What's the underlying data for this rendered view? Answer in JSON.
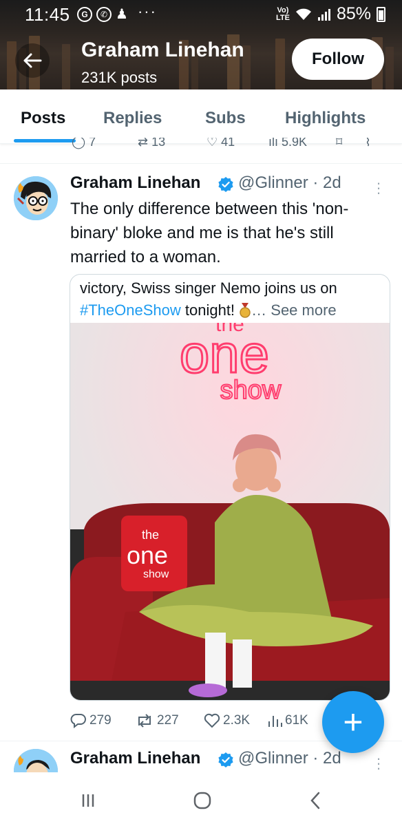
{
  "status_bar": {
    "time": "11:45",
    "network": "Vo) LTE",
    "battery": "85%"
  },
  "header": {
    "profile_name": "Graham Linehan",
    "posts_count": "231K posts",
    "follow_label": "Follow"
  },
  "tabs": [
    {
      "label": "Posts",
      "active": true
    },
    {
      "label": "Replies",
      "active": false
    },
    {
      "label": "Subs",
      "active": false
    },
    {
      "label": "Highlights",
      "active": false
    }
  ],
  "prev_post_actions": {
    "replies": "7",
    "reposts": "13",
    "likes": "41",
    "views": "5.9K"
  },
  "tweet": {
    "author_name": "Graham Linehan",
    "handle_time": "@Glinner · 2d",
    "text": "The only difference between this 'non-binary' bloke and me is that he's still married to a woman.",
    "embed": {
      "text_before": "victory, Swiss singer Nemo joins us on",
      "hashtag": "#TheOneShow",
      "text_after": " tonight! ",
      "see_more": "… See more",
      "sign_line1": "one",
      "sign_line2": "show",
      "sign_top": "the",
      "cushion_top": "the",
      "cushion_mid": "one",
      "cushion_bottom": "show"
    },
    "actions": {
      "replies": "279",
      "reposts": "227",
      "likes": "2.3K",
      "views": "61K"
    }
  },
  "next_tweet": {
    "author_name": "Graham Linehan",
    "handle_time": "@Glinner · 2d"
  },
  "colors": {
    "accent": "#1d9bf0",
    "text_primary": "#0f1419",
    "text_secondary": "#536471",
    "neon_pink": "#ff3d6e"
  }
}
